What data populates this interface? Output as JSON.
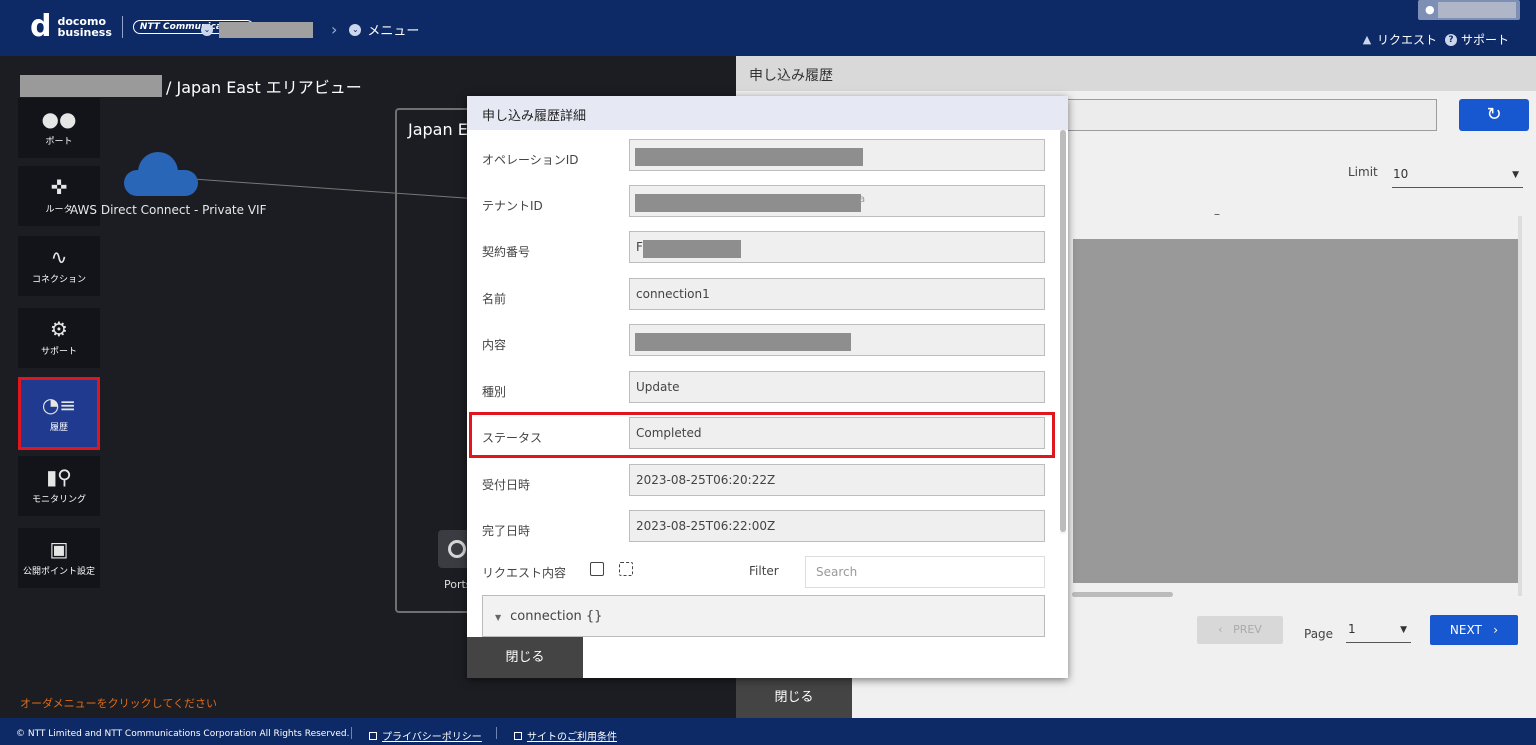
{
  "header": {
    "logo_top": "docomo",
    "logo_bottom": "business",
    "logo_ntt": "NTT Communications",
    "breadcrumb_menu": "メニュー",
    "request_label": "リクエスト",
    "support_label": "サポート"
  },
  "area": {
    "title": "/ Japan East エリアビュー",
    "cloud_label": "AWS Direct Connect - Private VIF",
    "box_label": "Japan E",
    "port_label": "Ports",
    "hint": "オーダメニューをクリックしてください"
  },
  "sidebar": {
    "items": [
      {
        "label": "ポート",
        "icon": "port-icon"
      },
      {
        "label": "ルータ",
        "icon": "router-icon"
      },
      {
        "label": "コネクション",
        "icon": "connection-icon"
      },
      {
        "label": "サポート",
        "icon": "support-icon"
      },
      {
        "label": "履歴",
        "icon": "history-icon"
      },
      {
        "label": "モニタリング",
        "icon": "monitoring-icon"
      },
      {
        "label": "公開ポイント設定",
        "icon": "public-point-icon"
      }
    ]
  },
  "history_panel": {
    "title": "申し込み履歴",
    "limit_label": "Limit",
    "limit_value": "10",
    "column_dash": "–",
    "prev_label": "PREV",
    "page_label": "Page",
    "page_value": "1",
    "next_label": "NEXT",
    "close_label": "閉じる"
  },
  "modal": {
    "title": "申し込み履歴詳細",
    "fields": [
      {
        "label": "オペレーションID",
        "value": ""
      },
      {
        "label": "テナントID",
        "value": ""
      },
      {
        "label": "契約番号",
        "value": "F"
      },
      {
        "label": "名前",
        "value": "connection1"
      },
      {
        "label": "内容",
        "value": ""
      },
      {
        "label": "種別",
        "value": "Update"
      },
      {
        "label": "ステータス",
        "value": "Completed"
      },
      {
        "label": "受付日時",
        "value": "2023-08-25T06:20:22Z"
      },
      {
        "label": "完了日時",
        "value": "2023-08-25T06:22:00Z"
      }
    ],
    "tenant_suffix": "a",
    "request_label": "リクエスト内容",
    "filter_label": "Filter",
    "search_placeholder": "Search",
    "json_root": "connection {}",
    "close_label": "閉じる"
  },
  "footer": {
    "copyright": "© NTT Limited and NTT Communications Corporation All Rights Reserved.",
    "privacy": "プライバシーポリシー",
    "terms": "サイトのご利用条件"
  },
  "colors": {
    "header_bg": "#0d2a66",
    "primary_button": "#1758d1",
    "highlight_red": "#e0161f",
    "active_sidebar": "#1f3a8f"
  }
}
